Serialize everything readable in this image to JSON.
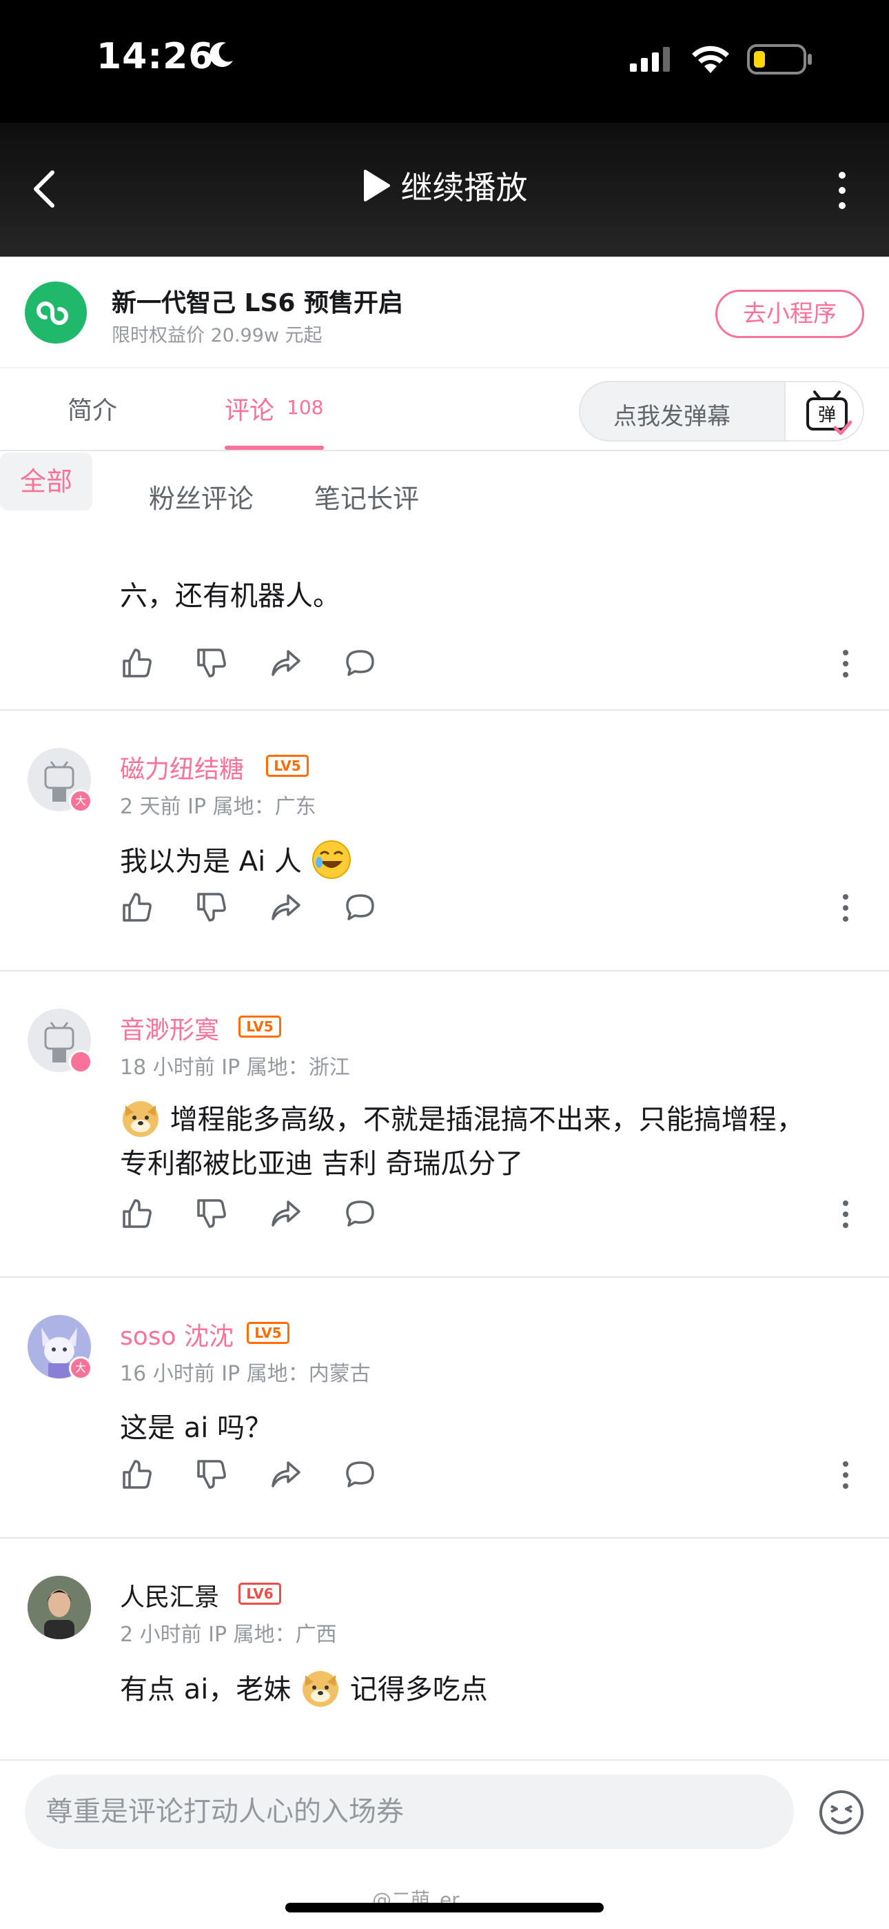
{
  "status": {
    "time": "14:26"
  },
  "header": {
    "play_label": "继续播放"
  },
  "ad": {
    "title": "新一代智己 LS6 预售开启",
    "subtitle": "限时权益价 20.99w 元起",
    "button": "去小程序"
  },
  "tabs": {
    "intro": "简介",
    "comments": "评论",
    "comments_count": "108",
    "danmaku_placeholder": "点我发弹幕",
    "danmaku_icon_text": "弹"
  },
  "filters": [
    "全部",
    "粉丝评论",
    "笔记长评"
  ],
  "comments": [
    {
      "text": "六，还有机器人。"
    },
    {
      "user": "磁力纽结糖",
      "level": "LV5",
      "badge": "大",
      "meta": "2 天前  IP 属地：广东",
      "text": "我以为是 Ai 人"
    },
    {
      "user": "音渺形寞",
      "level": "LV5",
      "badge": "",
      "meta": "18 小时前  IP 属地：浙江",
      "text": "增程能多高级，不就是插混搞不出来，只能搞增程，专利都被比亚迪 吉利 奇瑞瓜分了"
    },
    {
      "user": "soso 沈沈",
      "level": "LV5",
      "badge": "大",
      "meta": "16 小时前  IP 属地：内蒙古",
      "text": "这是 ai 吗？"
    },
    {
      "user": "人民汇景",
      "level": "LV6",
      "meta": "2 小时前  IP 属地：广西",
      "text_before": "有点 ai，老妹",
      "text_after": "记得多吃点"
    }
  ],
  "input": {
    "placeholder": "尊重是评论打动人心的入场券"
  },
  "watermark": "@二萌_er",
  "colors": {
    "accent": "#fb7299",
    "level": "#ff6c00",
    "level6": "#f04c49",
    "mini_program": "#20b86b"
  }
}
